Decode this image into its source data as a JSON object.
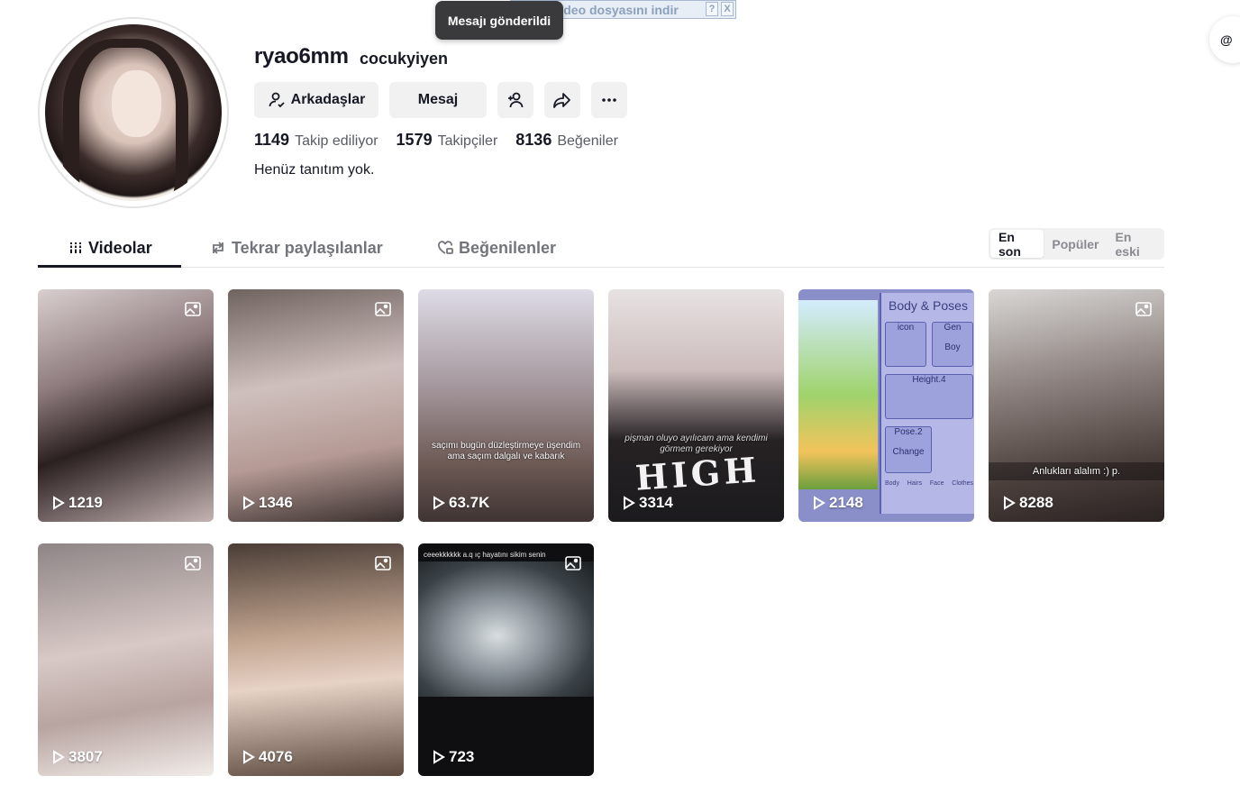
{
  "toast": {
    "text": "Mesajı gönderildi"
  },
  "download_bar": {
    "label": "Bu video dosyasını indir",
    "help": "?",
    "close": "X"
  },
  "profile": {
    "username": "ryao6mm",
    "nickname": "cocukyiyen",
    "bio": "Henüz tanıtım yok.",
    "buttons": {
      "friends": "Arkadaşlar",
      "message": "Mesaj"
    },
    "stats": [
      {
        "value": "1149",
        "label": "Takip ediliyor"
      },
      {
        "value": "1579",
        "label": "Takipçiler"
      },
      {
        "value": "8136",
        "label": "Beğeniler"
      }
    ]
  },
  "tabs": {
    "videos": "Videolar",
    "reposts": "Tekrar paylaşılanlar",
    "liked": "Beğenilenler"
  },
  "sort": {
    "latest": "En son",
    "popular": "Popüler",
    "oldest": "En eski",
    "active": "latest"
  },
  "videos": [
    {
      "views": "1219"
    },
    {
      "views": "1346"
    },
    {
      "views": "63.7K",
      "caption": "saçımı bugün düzleştirmeye üşendim ama saçım dalgalı ve kabarık"
    },
    {
      "views": "3314",
      "caption": "pişman oluyo ayılıcam ama kendimi görmem gerekiyor",
      "shirt": "HIGH"
    },
    {
      "views": "2148",
      "gacha": {
        "title": "Body & Poses",
        "icon": "icon",
        "gen": "Gen",
        "boy": "Boy",
        "height": "Height.4",
        "pose": "Pose.2",
        "change": "Change",
        "bottom": [
          "Body",
          "Hairs",
          "Face",
          "Clothes"
        ]
      }
    },
    {
      "views": "8288",
      "caption": "Anlukları alalım :) p."
    },
    {
      "views": "3807"
    },
    {
      "views": "4076"
    },
    {
      "views": "723",
      "caption": "ceeekkkkkk a.q ıç hayatını sikim  senin"
    }
  ],
  "corner_button": {
    "label": "@"
  }
}
